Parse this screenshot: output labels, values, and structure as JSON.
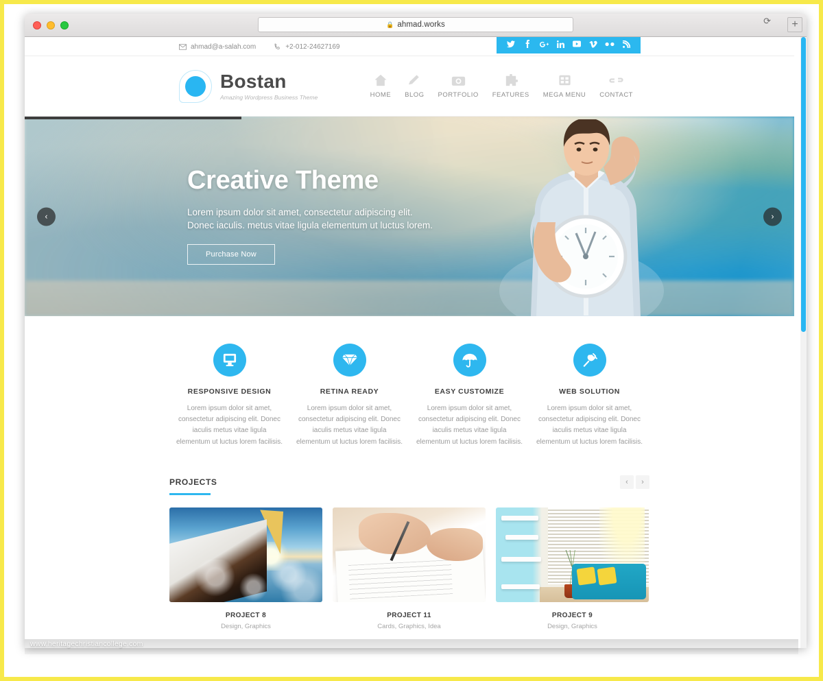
{
  "browser": {
    "url": "ahmad.works",
    "lock_icon": "lock-icon",
    "reload_icon": "reload-icon",
    "new_tab_label": "+"
  },
  "topbar": {
    "email": "ahmad@a-salah.com",
    "phone": "+2-012-24627169",
    "social": [
      {
        "name": "twitter",
        "glyph": "t"
      },
      {
        "name": "facebook",
        "glyph": "f"
      },
      {
        "name": "google-plus",
        "glyph": "g"
      },
      {
        "name": "linkedin",
        "glyph": "in"
      },
      {
        "name": "youtube",
        "glyph": "yt"
      },
      {
        "name": "vimeo",
        "glyph": "V"
      },
      {
        "name": "flickr",
        "glyph": "••"
      },
      {
        "name": "rss",
        "glyph": "rss"
      }
    ]
  },
  "header": {
    "logo_name": "Bostan",
    "logo_tagline": "Amazing Wordpress Business Theme",
    "nav": [
      {
        "label": "HOME",
        "icon": "home-icon"
      },
      {
        "label": "BLOG",
        "icon": "pencil-icon"
      },
      {
        "label": "PORTFOLIO",
        "icon": "camera-icon"
      },
      {
        "label": "FEATURES",
        "icon": "puzzle-icon"
      },
      {
        "label": "MEGA MENU",
        "icon": "grid-icon"
      },
      {
        "label": "CONTACT",
        "icon": "link-icon"
      }
    ]
  },
  "hero": {
    "title": "Creative Theme",
    "subtitle_line1": "Lorem ipsum dolor sit amet, consectetur adipiscing elit.",
    "subtitle_line2": "Donec iaculis. metus vitae ligula elementum ut luctus lorem.",
    "button_label": "Purchase Now",
    "prev_arrow": "‹",
    "next_arrow": "›"
  },
  "features": [
    {
      "icon": "monitor-icon",
      "title": "RESPONSIVE DESIGN",
      "body": "Lorem ipsum dolor sit amet, consectetur adipiscing elit. Donec iaculis metus vitae ligula elementum ut luctus lorem facilisis."
    },
    {
      "icon": "diamond-icon",
      "title": "RETINA READY",
      "body": "Lorem ipsum dolor sit amet, consectetur adipiscing elit. Donec iaculis metus vitae ligula elementum ut luctus lorem facilisis."
    },
    {
      "icon": "umbrella-icon",
      "title": "EASY CUSTOMIZE",
      "body": "Lorem ipsum dolor sit amet, consectetur adipiscing elit. Donec iaculis metus vitae ligula elementum ut luctus lorem facilisis."
    },
    {
      "icon": "plug-icon",
      "title": "WEB SOLUTION",
      "body": "Lorem ipsum dolor sit amet, consectetur adipiscing elit. Donec iaculis metus vitae ligula elementum ut luctus lorem facilisis."
    }
  ],
  "projects": {
    "heading": "PROJECTS",
    "prev_arrow": "‹",
    "next_arrow": "›",
    "items": [
      {
        "name": "PROJECT 8",
        "categories": "Design, Graphics",
        "image": "sailboat-photo"
      },
      {
        "name": "PROJECT 11",
        "categories": "Cards, Graphics, Idea",
        "image": "signing-document-photo"
      },
      {
        "name": "PROJECT 9",
        "categories": "Design, Graphics",
        "image": "living-room-photo"
      }
    ]
  },
  "watermark": "www.heritagechristiancollege.com",
  "colors": {
    "accent": "#2eb7ef",
    "social_bar": "#2bb8ef",
    "heading": "#3d3d3d",
    "muted": "#9a9a9a",
    "frame": "#f7e94a"
  }
}
